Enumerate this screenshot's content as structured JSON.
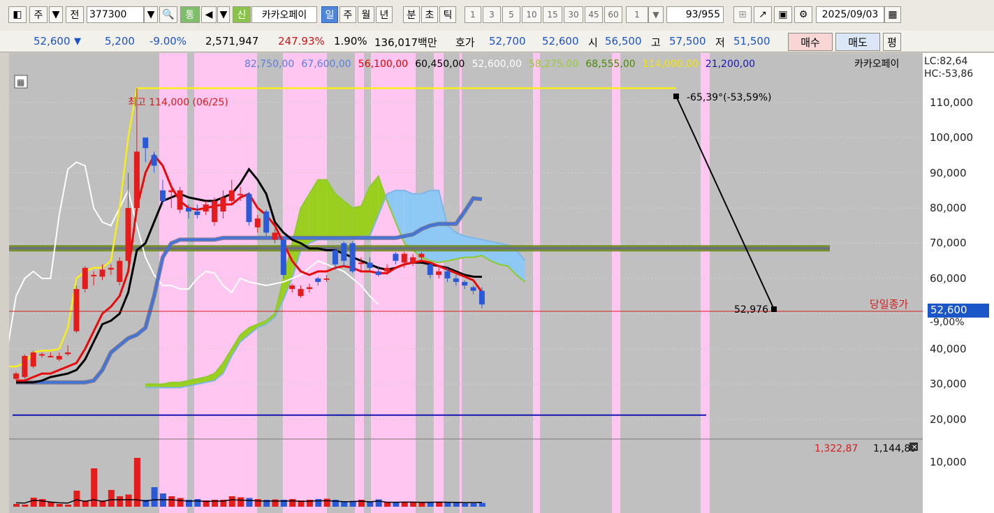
{
  "toolbar": {
    "market": "주",
    "prev": "전",
    "code": "377300",
    "tong": "통",
    "sin": "신",
    "name": "카카오페이",
    "periods": [
      "일",
      "주",
      "월",
      "년",
      "분",
      "초",
      "틱"
    ],
    "intervals": [
      "1",
      "3",
      "5",
      "10",
      "15",
      "30",
      "45",
      "60"
    ],
    "count_val": "1",
    "page": "93/955",
    "date": "2025/09/03"
  },
  "pricebar": {
    "price": "52,600",
    "arrow": "▼",
    "change": "5,200",
    "pct": "-9.00%",
    "volume": "2,571,947",
    "vol_ratio": "247.93%",
    "turnover": "1.90%",
    "amount": "136,017백만",
    "hoga_label": "호가",
    "ask": "52,700",
    "bid": "52,600",
    "open_label": "시",
    "open": "56,500",
    "high_label": "고",
    "high": "57,500",
    "low_label": "저",
    "low": "51,500",
    "buy": "매수",
    "sell": "매도",
    "eval": "평"
  },
  "chart_data": {
    "type": "line",
    "legend_values": [
      {
        "text": "82,750,00",
        "color": "#5a7de0"
      },
      {
        "text": "67,600,00",
        "color": "#5a7de0"
      },
      {
        "text": "56,100,00",
        "color": "#e00000"
      },
      {
        "text": "60,450,00",
        "color": "#000000"
      },
      {
        "text": "52,600,00",
        "color": "#ffffff"
      },
      {
        "text": "58,275,00",
        "color": "#9acd32"
      },
      {
        "text": "68,555,00",
        "color": "#4a8a00"
      },
      {
        "text": "114,000,00",
        "color": "#f2e600"
      },
      {
        "text": "21,200,00",
        "color": "#1515b0"
      }
    ],
    "right_labels": [
      {
        "text": "LC:82,64",
        "color": "#d21414"
      },
      {
        "text": "HC:-53,86",
        "color": "#1a53c9"
      }
    ],
    "product": "카카오페이",
    "annotation_high": "최고 114,000 (06/25)",
    "trend_label": "-65,39°(-53,59%)",
    "target_value": "52,976",
    "close_label": "당일종가",
    "current_price": "52,600",
    "current_pct": "-9,00%",
    "y_ticks": [
      "110,000",
      "100,000",
      "90,000",
      "80,000",
      "70,000",
      "60,000",
      "50,000",
      "40,000",
      "30,000",
      "20,000"
    ],
    "y_values": [
      110000,
      100000,
      90000,
      80000,
      70000,
      60000,
      50000,
      40000,
      30000,
      20000
    ],
    "volume_legend": {
      "a": "1,322,87",
      "b": "1,144,89"
    },
    "volume_tick": "10,000",
    "ylim": [
      16000,
      122000
    ],
    "x": [
      0,
      1,
      2,
      3,
      4,
      5,
      6,
      7,
      8,
      9,
      10,
      11,
      12,
      13,
      14,
      15,
      16,
      17,
      18,
      19,
      20,
      21,
      22,
      23,
      24,
      25,
      26,
      27,
      28,
      29,
      30,
      31,
      32,
      33,
      34,
      35,
      36,
      37,
      38,
      39,
      40,
      41,
      42,
      43,
      44,
      45,
      46,
      47,
      48,
      49,
      50,
      51,
      52,
      53,
      54,
      55,
      56,
      57,
      58,
      59,
      60,
      61,
      62,
      63,
      64,
      65,
      66,
      67,
      68,
      69,
      70,
      71,
      72,
      73,
      74,
      75,
      76,
      77,
      78,
      79,
      80,
      81,
      82,
      83
    ],
    "candles": {
      "open": [
        31500,
        32000,
        35000,
        38500,
        38000,
        37000,
        38500,
        45000,
        57000,
        61000,
        60500,
        62500,
        59000,
        65000,
        80000,
        100000,
        95000,
        85000,
        84500,
        79500,
        80000,
        79000,
        79000,
        76000,
        79000,
        82000,
        84000,
        84000,
        74500,
        79000,
        71000,
        71000,
        57000,
        55000,
        57000,
        60000,
        60000,
        68000,
        70000,
        70000,
        64500,
        64500,
        62000,
        62000,
        67000,
        64500,
        64500,
        66000,
        64000,
        61000,
        62000,
        60000,
        59000,
        57500,
        56500
      ],
      "close": [
        33000,
        38000,
        39000,
        38500,
        38000,
        38000,
        39000,
        57000,
        63000,
        61000,
        62500,
        63000,
        65000,
        80000,
        96000,
        97000,
        92000,
        82000,
        85000,
        85000,
        79000,
        78000,
        81000,
        82000,
        83000,
        85000,
        84000,
        76000,
        77000,
        73000,
        73000,
        61000,
        58000,
        57000,
        57500,
        59000,
        60000,
        64000,
        65000,
        62000,
        64500,
        63000,
        61000,
        63000,
        65000,
        67000,
        66000,
        67000,
        61000,
        62000,
        60000,
        59000,
        58000,
        56500,
        52600
      ],
      "high": [
        33500,
        38500,
        39500,
        39000,
        39000,
        39000,
        41000,
        58000,
        63500,
        62000,
        64000,
        64000,
        66000,
        90000,
        114000,
        100000,
        96000,
        88000,
        86000,
        86000,
        81000,
        81000,
        82000,
        83000,
        85000,
        88000,
        86000,
        84500,
        78000,
        79500,
        74000,
        71500,
        58500,
        58000,
        58500,
        60500,
        61000,
        68500,
        70500,
        70500,
        66000,
        66000,
        63500,
        64000,
        67500,
        67500,
        67000,
        67500,
        64500,
        63000,
        63000,
        61000,
        59500,
        58000,
        57500
      ],
      "low": [
        31000,
        31500,
        34500,
        37500,
        37500,
        36500,
        38000,
        44500,
        56000,
        58000,
        59500,
        61000,
        58000,
        64000,
        78000,
        93000,
        90000,
        81000,
        80000,
        78500,
        77000,
        77000,
        78000,
        75000,
        77000,
        81000,
        82000,
        75000,
        73000,
        72000,
        70000,
        60000,
        56000,
        54500,
        56000,
        58000,
        59000,
        62500,
        63500,
        61500,
        62000,
        62000,
        60500,
        61000,
        64000,
        63000,
        63500,
        65000,
        60000,
        60000,
        59000,
        58000,
        57000,
        55500,
        51500
      ]
    },
    "series_conversion": [
      31000,
      31000,
      32000,
      33000,
      33000,
      34000,
      35000,
      36000,
      40000,
      45000,
      50000,
      52000,
      55000,
      62000,
      80000,
      90000,
      95000,
      92000,
      86000,
      82000,
      80000,
      79500,
      80000,
      80500,
      81000,
      81000,
      83000,
      84000,
      80000,
      78000,
      75000,
      70000,
      65000,
      62000,
      61000,
      62000,
      62000,
      63000,
      63500,
      63000,
      62000,
      62000,
      61500,
      61500,
      63000,
      64000,
      64500,
      65000,
      64500,
      63500,
      62500,
      61500,
      60500,
      59500,
      56100
    ],
    "series_base": [
      30500,
      30500,
      30500,
      31000,
      32000,
      32500,
      33000,
      34000,
      37000,
      42000,
      47000,
      48000,
      50000,
      56000,
      68000,
      70000,
      76000,
      82000,
      83000,
      84000,
      83000,
      82500,
      82000,
      82000,
      83000,
      84000,
      87000,
      91000,
      88000,
      84000,
      76000,
      73000,
      71000,
      70000,
      68500,
      68500,
      68000,
      68000,
      67000,
      66000,
      65000,
      64000,
      63000,
      62500,
      63000,
      64000,
      64500,
      64500,
      64000,
      63500,
      63000,
      62000,
      61000,
      60500,
      60450
    ],
    "series_lagging": [
      38000,
      40000,
      55000,
      60000,
      62000,
      60000,
      60000,
      78000,
      91000,
      93000,
      92000,
      80000,
      76000,
      75000,
      80000,
      85000,
      75000,
      66000,
      61000,
      58000,
      58000,
      57000,
      57000,
      60000,
      62000,
      61500,
      58000,
      56000,
      60000,
      59000,
      58500,
      58000,
      58500,
      59000,
      60000,
      61000,
      63000,
      65000,
      64000,
      63000,
      62000,
      60000,
      58000,
      55000,
      52600
    ],
    "series_yellow": [
      35000,
      35000,
      36000,
      39000,
      39500,
      39500,
      40000,
      46000,
      60000,
      62000,
      63000,
      63000,
      65000,
      80000,
      100000,
      114000,
      114000
    ],
    "ichimoku_a": [
      30000,
      30000,
      30000,
      30500,
      30500,
      31000,
      31500,
      32000,
      33000,
      36000,
      40000,
      44000,
      46000,
      47000,
      48000,
      50000,
      60000,
      70000,
      80000,
      84000,
      88000,
      88000,
      84000,
      82000,
      80000,
      80500,
      86000,
      89000,
      82000,
      76000,
      70000,
      68000,
      66000,
      65000,
      64500,
      65000,
      65500,
      66000,
      66000,
      66500,
      65000,
      64000,
      63500,
      61000,
      59000
    ],
    "ichimoku_b": [
      29000,
      29000,
      29000,
      29000,
      29000,
      29500,
      30000,
      30500,
      31000,
      33000,
      38000,
      42000,
      44000,
      46000,
      47000,
      49000,
      54000,
      60000,
      68000,
      70000,
      71000,
      71000,
      71000,
      71000,
      71500,
      72000,
      72000,
      78000,
      84000,
      85000,
      85000,
      84000,
      84000,
      85000,
      85000,
      75000,
      73000,
      72000,
      71500,
      71000,
      70500,
      70000,
      69500,
      68000,
      65000
    ],
    "series_blue_lead": [
      30500,
      30500,
      30500,
      30500,
      30500,
      30500,
      30500,
      30500,
      30500,
      31000,
      34000,
      39000,
      41000,
      43000,
      44000,
      46000,
      55000,
      66000,
      70000,
      71000,
      71000,
      71000,
      71000,
      71000,
      71500,
      71500,
      71500,
      71500,
      71500,
      71500,
      71500,
      71500,
      71500,
      71500,
      71500,
      71500,
      71500,
      71500,
      71500,
      71500,
      71500,
      71500,
      71500,
      71500,
      71500,
      72000,
      72500,
      74000,
      75000,
      75500,
      75500,
      75500,
      79000,
      82750,
      82500
    ],
    "hline_green": 68555,
    "hline_blue": 21200,
    "close_line": 52600,
    "volume": [
      80,
      60,
      260,
      220,
      140,
      80,
      60,
      460,
      180,
      1100,
      180,
      480,
      300,
      350,
      1400,
      200,
      560,
      380,
      300,
      250,
      200,
      220,
      180,
      200,
      200,
      300,
      270,
      250,
      220,
      200,
      210,
      200,
      220,
      180,
      200,
      220,
      230,
      200,
      160,
      170,
      200,
      150,
      210,
      120,
      120,
      130,
      130,
      110,
      120,
      130,
      120,
      110,
      100,
      100,
      110
    ]
  }
}
